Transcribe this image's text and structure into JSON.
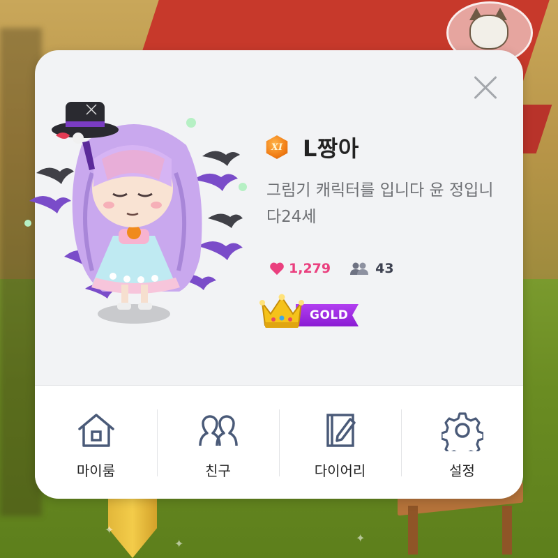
{
  "profile": {
    "level_badge": "XI",
    "username": "L짱아",
    "bio": "그림기 캐릭터를 입니다 윤 정입니다24세",
    "likes": "1,279",
    "followers": "43",
    "grade": "GOLD"
  },
  "menu": [
    {
      "label": "마이룸",
      "icon": "house-icon"
    },
    {
      "label": "친구",
      "icon": "friends-icon"
    },
    {
      "label": "다이어리",
      "icon": "diary-icon"
    },
    {
      "label": "설정",
      "icon": "gear-icon"
    }
  ],
  "colors": {
    "likes": "#ea3f7e",
    "grade_ribbon": "#9b2be0",
    "icon_stroke": "#4a5a78",
    "card_bg": "#f2f3f5"
  }
}
